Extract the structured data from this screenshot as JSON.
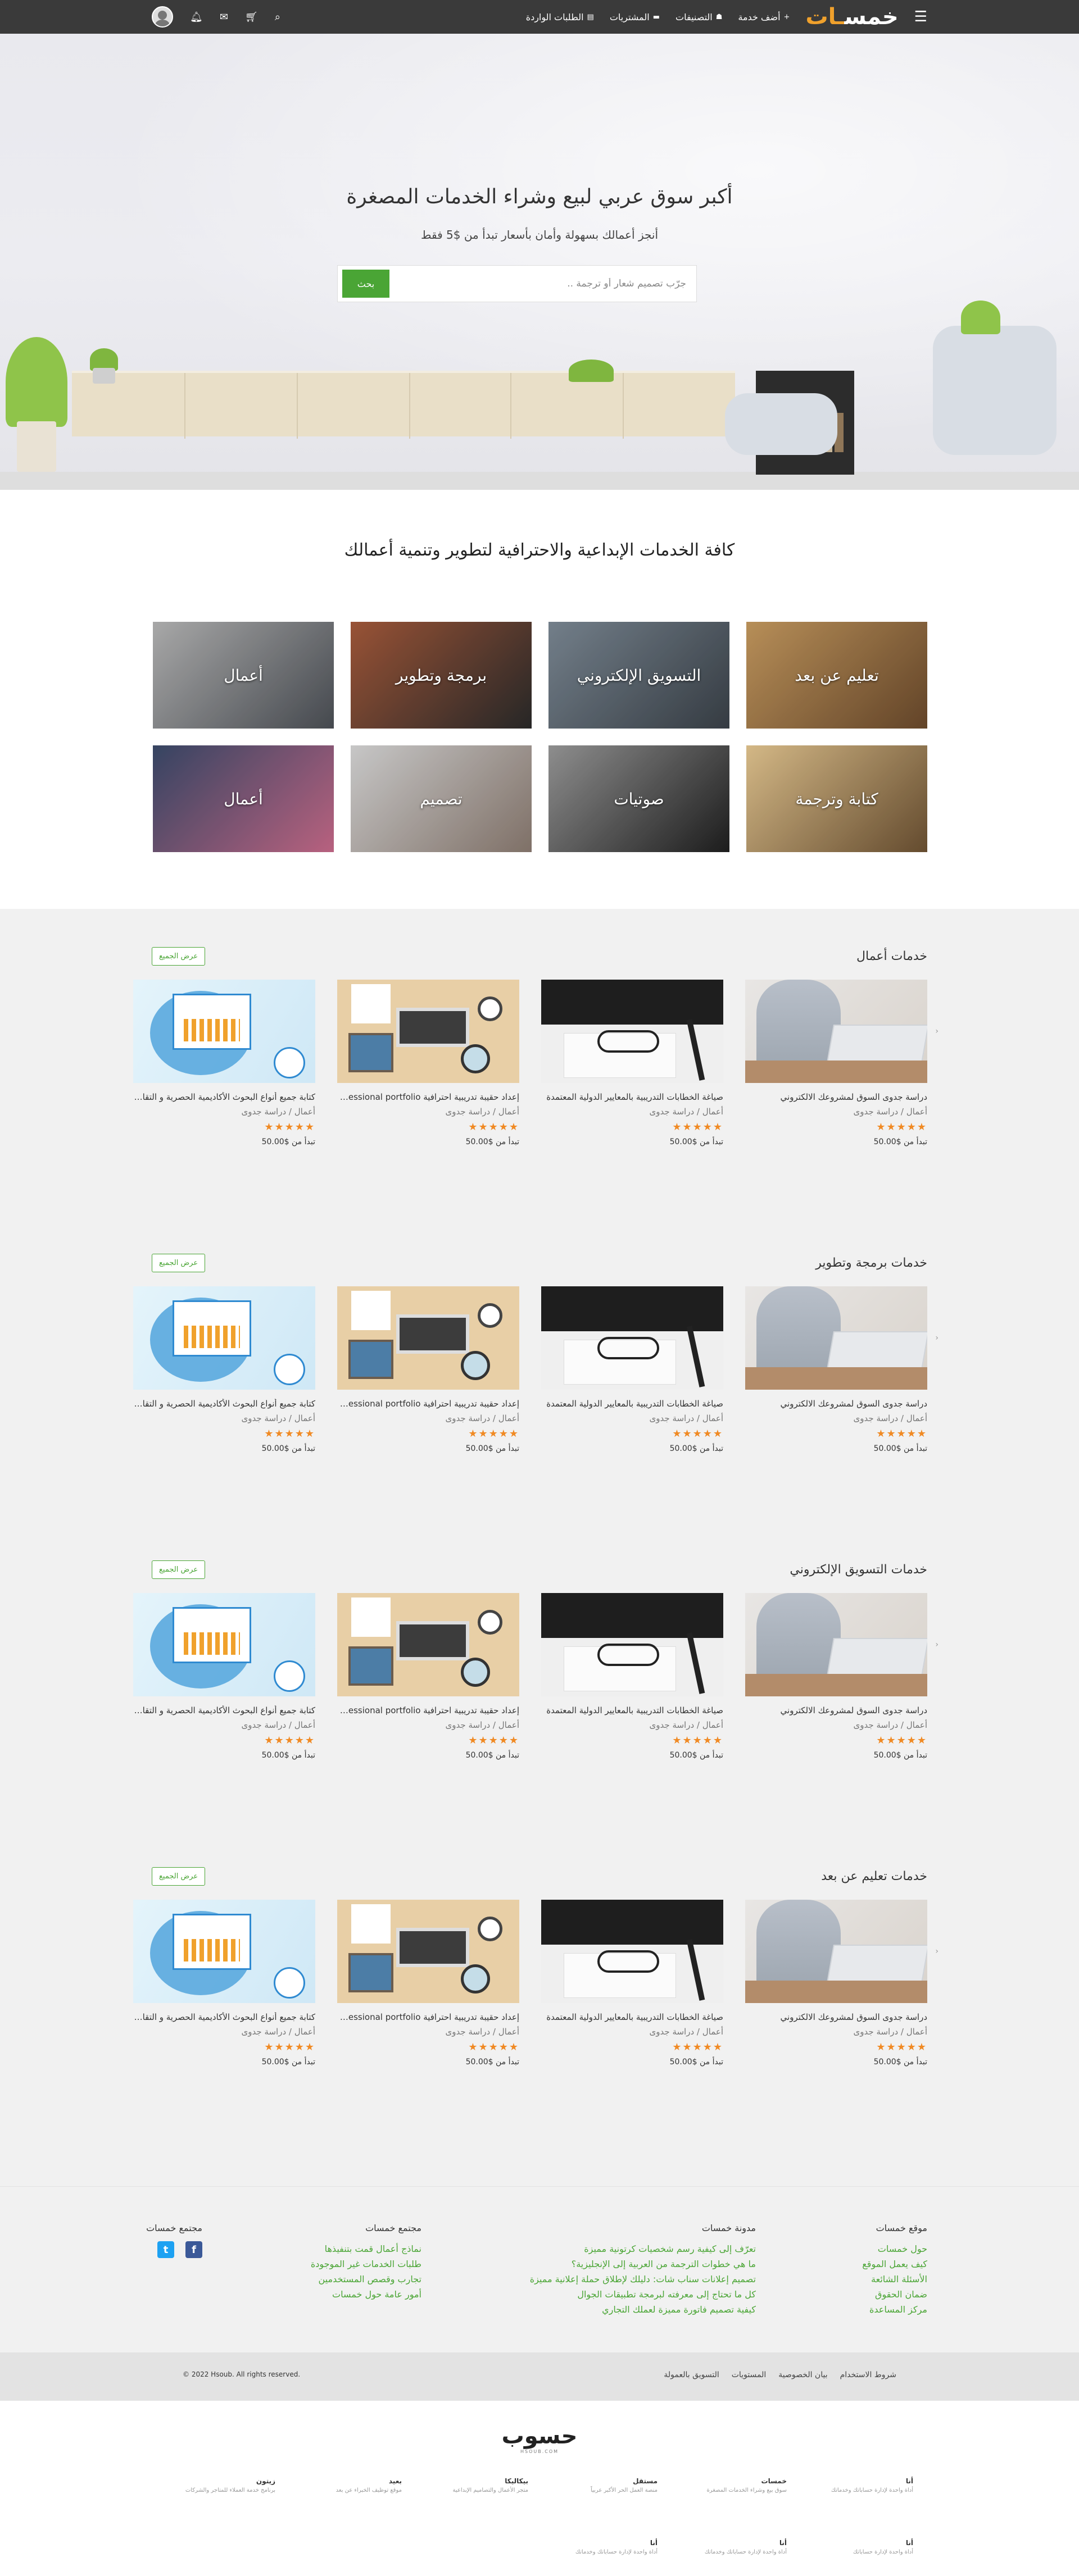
{
  "nav": {
    "logo_main": "خمس",
    "logo_accent": "ـات",
    "links": [
      "أضف خدمة",
      "التصنيفات",
      "المشتريات",
      "الطلبات الواردة"
    ],
    "link_icons": [
      "plus-icon",
      "tags-icon",
      "folder-icon",
      "inbox-icon"
    ]
  },
  "hero": {
    "title": "أكبر سوق عربي لبيع وشراء الخدمات المصغرة",
    "subtitle": "أنجز أعمالك بسهولة وأمان بأسعار تبدأ من $5 فقط",
    "search_placeholder": "جرّب تصميم شعار أو ترجمة ..",
    "search_button": "بحث"
  },
  "categories": {
    "heading": "كافة الخدمات الإبداعية والاحترافية لتطوير وتنمية أعمالك",
    "items": [
      "تعليم عن بعد",
      "التسويق الإلكتروني",
      "برمجة وتطوير",
      "أعمال",
      "كتابة وترجمة",
      "صوتيات",
      "تصميم",
      "أعمال"
    ]
  },
  "view_all": "عرض الجميع",
  "sections": [
    {
      "title": "خدمات أعمال"
    },
    {
      "title": "خدمات برمجة وتطوير"
    },
    {
      "title": "خدمات التسويق الإلكتروني"
    },
    {
      "title": "خدمات تعليم عن بعد"
    }
  ],
  "cards": [
    {
      "title": "دراسة جدوى السوق لمشروعك الالكتروني",
      "meta": "أعمال / دراسة جدوى",
      "price": "تبدأ من $50.00",
      "rating": 5
    },
    {
      "title": "صياغة الخطابات التدريبية بالمعايير الدولية المعتمدة",
      "meta": "أعمال / دراسة جدوى",
      "price": "تبدأ من $50.00",
      "rating": 5
    },
    {
      "title": "إعداد حقيبة تدريبية احترافية professional portfolio",
      "meta": "أعمال / دراسة جدوى",
      "price": "تبدأ من $50.00",
      "rating": 5
    },
    {
      "title": "كتابة جميع أنواع البحوث الأكاديمية الحصرية و التقارير",
      "meta": "أعمال / دراسة جدوى",
      "price": "تبدأ من $50.00",
      "rating": 5
    }
  ],
  "footer": {
    "col1": {
      "title": "موقع خمسات",
      "links": [
        "حول خمسات",
        "كيف يعمل الموقع",
        "الأسئلة الشائعة",
        "ضمان الحقوق",
        "مركز المساعدة"
      ]
    },
    "col2": {
      "title": "مدونة خمسات",
      "links": [
        "تعرّف إلى كيفية رسم شخصيات كرتونية مميزة",
        "ما هي خطوات الترجمة من العربية إلى الإنجليزية؟",
        "تصميم إعلانات سناب شات: دليلك لإطلاق حملة إعلانية مميزة",
        "كل ما تحتاج إلى معرفته لبرمجة تطبيقات الجوال",
        "كيفية تصميم فاتورة مميزة لعملك التجاري"
      ]
    },
    "col3": {
      "title": "مجتمع خمسات",
      "links": [
        "نماذج أعمال قمت بتنفيذها",
        "طلبات الخدمات غير الموجودة",
        "تجارب وقصص المستخدمين",
        "أمور عامة حول خمسات"
      ]
    },
    "col4": {
      "title": "مجتمع خمسات",
      "social": [
        "facebook-icon",
        "twitter-icon"
      ]
    },
    "bottom_links": [
      "شروط الاستخدام",
      "بيان الخصوصية",
      "المستويات",
      "التسويق بالعمولة"
    ],
    "copyright": "© 2022 Hsoub. All rights reserved."
  },
  "hsoub": {
    "logo": "حسوب",
    "logo_sub": "HSOUB.COM",
    "products": [
      {
        "name": "أنا",
        "desc": "أداة واحدة لإدارة حساباتك وخدماتك"
      },
      {
        "name": "خمسات",
        "desc": "سوق بيع وشراء الخدمات المصغرة"
      },
      {
        "name": "مستقل",
        "desc": "منصة العمل الحر الأكبر عربياً"
      },
      {
        "name": "بيكاليكا",
        "desc": "متجر الأعمال والتصاميم الإبداعية"
      },
      {
        "name": "بعيد",
        "desc": "موقع توظيف الخبراء عن بعد"
      },
      {
        "name": "زيتون",
        "desc": "برنامج خدمة العملاء للمتاجر والشركات"
      },
      {
        "name": "أنا",
        "desc": "أداة واحدة لإدارة حساباتك"
      },
      {
        "name": "أنا",
        "desc": "أداة واحدة لإدارة حساباتك وخدماتك"
      },
      {
        "name": "أنا",
        "desc": "أداة واحدة لإدارة حساباتك وخدماتك"
      }
    ]
  }
}
